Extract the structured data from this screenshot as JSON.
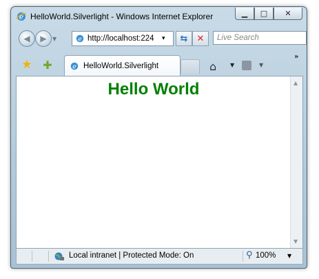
{
  "window": {
    "title": "HelloWorld.Silverlight - Windows Internet Explorer"
  },
  "address_bar": {
    "url": "http://localhost:224",
    "dropdown_glyph": "▾"
  },
  "search": {
    "placeholder": "Live Search"
  },
  "tab": {
    "label": "HelloWorld.Silverlight"
  },
  "page": {
    "heading": "Hello World",
    "heading_color": "#008000"
  },
  "status_bar": {
    "zone": "Local intranet | Protected Mode: On",
    "zoom": "100%"
  },
  "icons": {
    "app": "ie-logo-icon",
    "back": "back-arrow-icon",
    "forward": "forward-arrow-icon",
    "refresh": "refresh-icon",
    "stop": "stop-icon",
    "favorites": "star-icon",
    "add_favorite": "add-favorite-icon",
    "home": "home-icon",
    "feeds": "rss-feed-icon",
    "zone": "intranet-globe-icon",
    "zoom": "magnifier-icon"
  }
}
